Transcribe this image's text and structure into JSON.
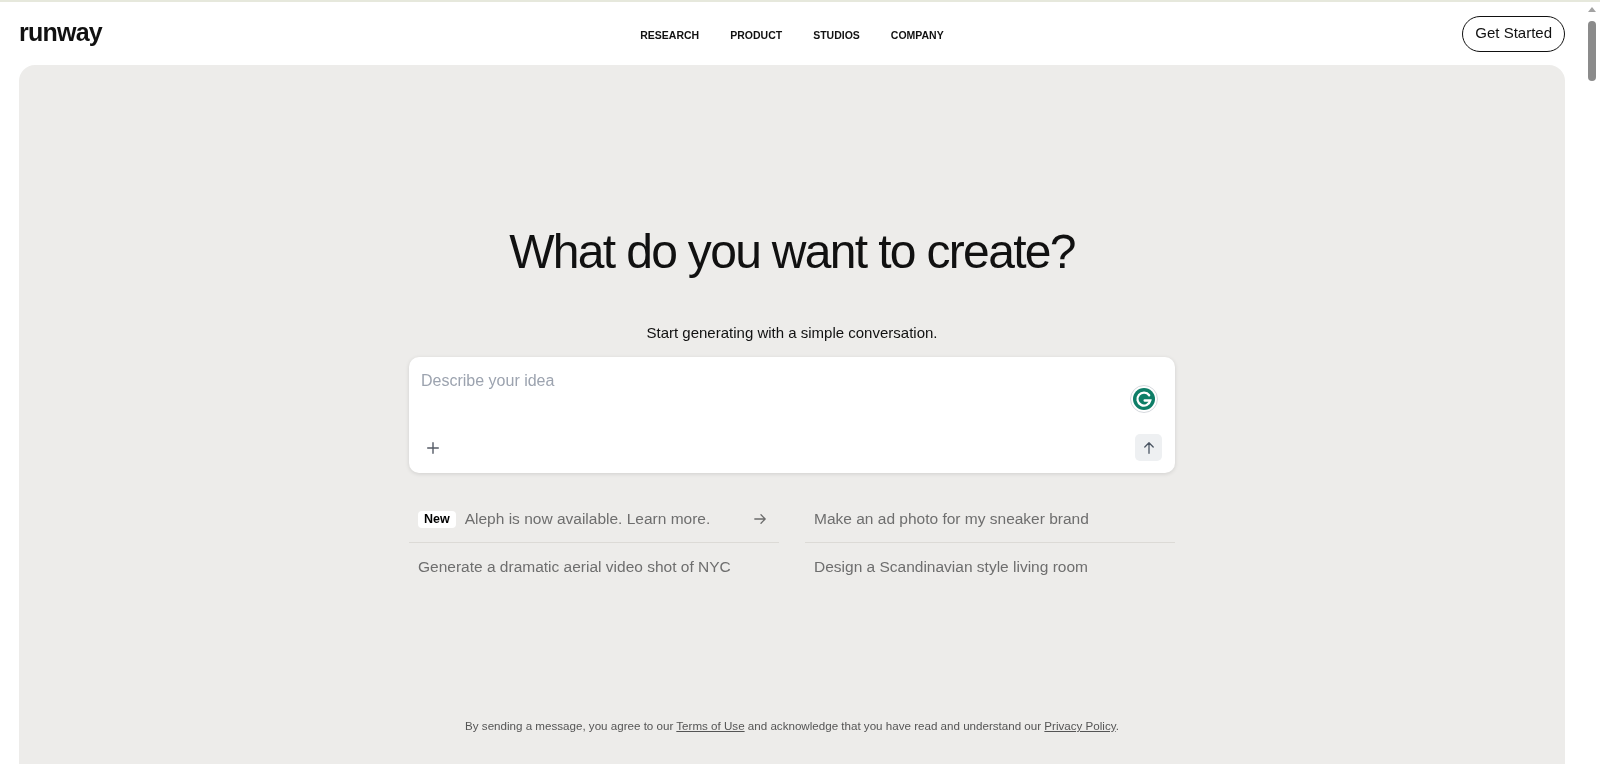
{
  "header": {
    "logo": "runway",
    "nav": [
      "RESEARCH",
      "PRODUCT",
      "STUDIOS",
      "COMPANY"
    ],
    "cta": "Get Started"
  },
  "hero": {
    "title": "What do you want to create?",
    "subtitle": "Start generating with a simple conversation."
  },
  "prompt": {
    "placeholder": "Describe your idea"
  },
  "suggestions": [
    {
      "kind": "announcement",
      "badge": "New",
      "text": "Aleph is now available. Learn more."
    },
    {
      "kind": "prompt",
      "text": "Make an ad photo for my sneaker brand"
    },
    {
      "kind": "prompt",
      "text": "Generate a dramatic aerial video shot of NYC"
    },
    {
      "kind": "prompt",
      "text": "Design a Scandinavian style living room"
    }
  ],
  "notice": {
    "before": "By sending a message, you agree to our",
    "terms_link": "Terms of Use",
    "middle": "and acknowledge that you have read and understand our",
    "privacy_link": "Privacy Policy",
    "after": "."
  }
}
